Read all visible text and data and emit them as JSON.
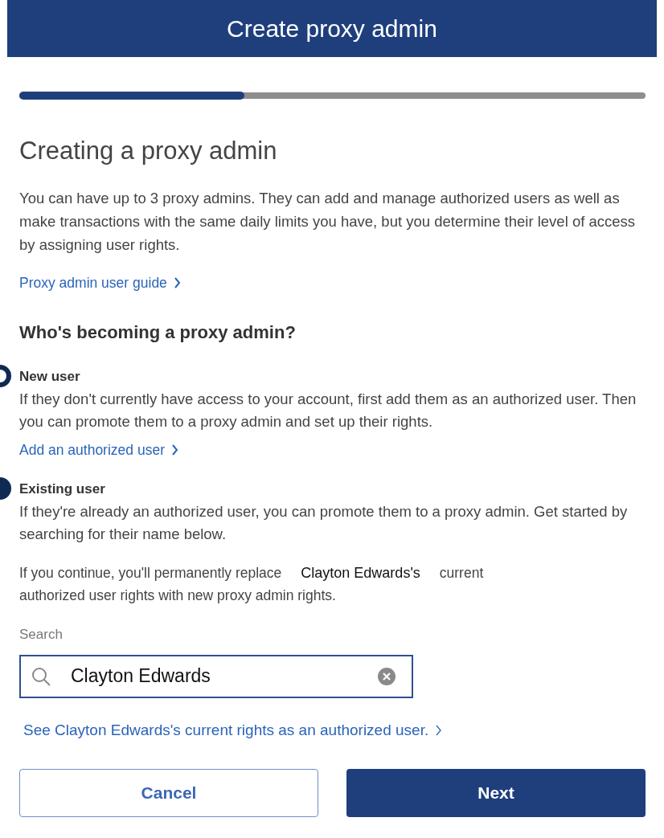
{
  "header": {
    "title": "Create proxy admin"
  },
  "progress": {
    "level": 0.36
  },
  "heading": "Creating a proxy admin",
  "intro": "You can have up to 3 proxy admins. They can add and manage authorized users as well as make transactions with the same daily limits you have, but you determine their level of access by assigning user rights.",
  "guide_link": "Proxy admin user guide",
  "question": "Who's becoming a proxy admin?",
  "options": [
    {
      "title": "New user",
      "selected": false,
      "description": "If they don't currently have access to your account, first add them as an authorized user. Then you can promote them to a proxy admin and set up their rights.",
      "link": "Add an authorized user"
    },
    {
      "title": "Existing user",
      "selected": true,
      "description": "If they're already an authorized user, you can promote them to a proxy admin. Get started by searching for their name below."
    }
  ],
  "warning": {
    "before": "If you continue, you'll permanently replace",
    "name": "Clayton Edwards's",
    "after": "current",
    "rest": "authorized user rights with new proxy admin rights."
  },
  "search": {
    "label": "Search",
    "value": "Clayton Edwards"
  },
  "rights_link": "See Clayton Edwards's current rights as an authorized user.",
  "buttons": [
    {
      "kind": "secondary",
      "label": "Cancel"
    },
    {
      "kind": "primary",
      "label": "Next"
    }
  ]
}
